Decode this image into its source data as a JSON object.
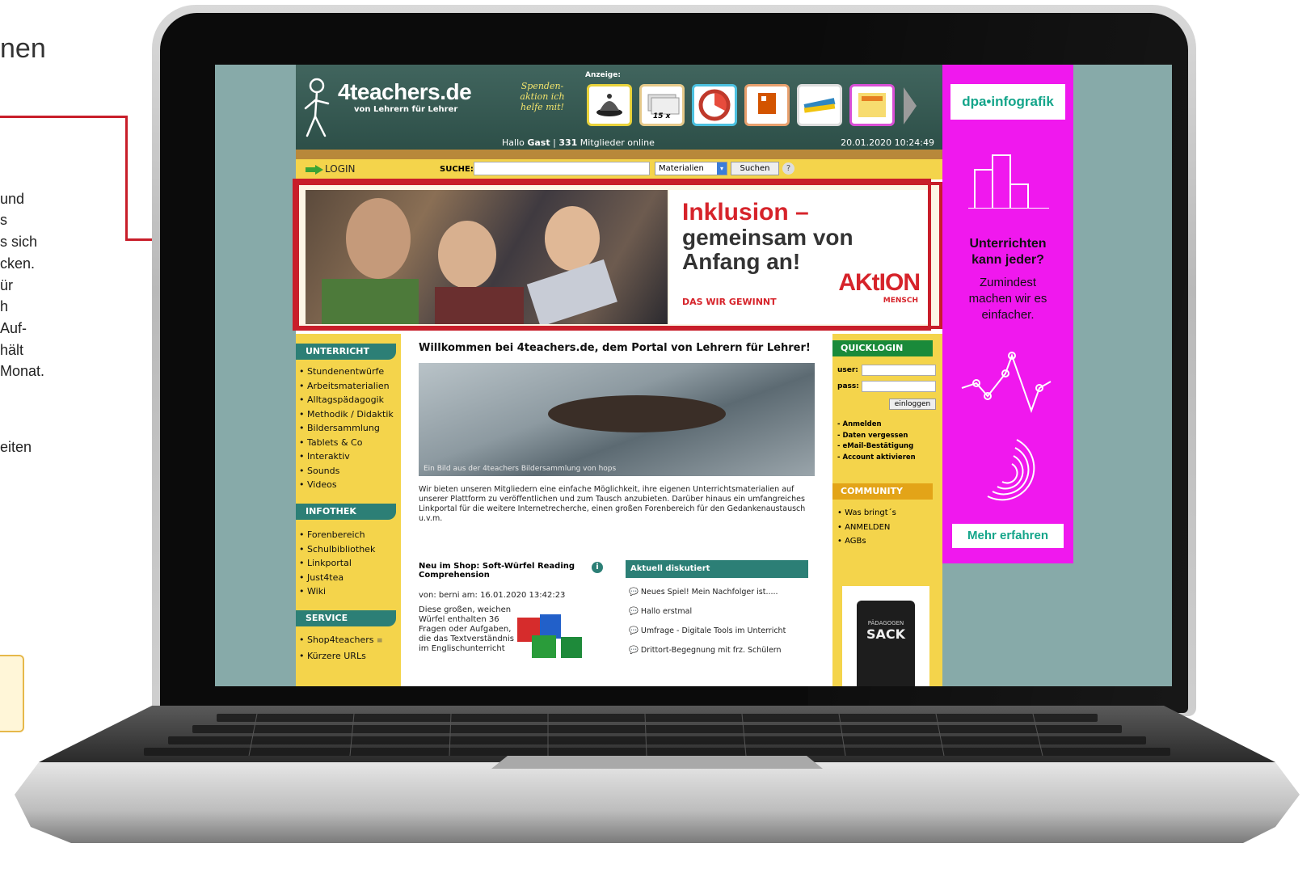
{
  "left_text": {
    "line0": "nen",
    "line1": "und",
    "line2": "s",
    "line3": "s sich",
    "line4": "cken.",
    "line5": "ür",
    "line6": "h",
    "line7": "Auf-",
    "line8": "hält",
    "line9": "Monat.",
    "line10": "eiten"
  },
  "site": {
    "logo_title": "4teachers.de",
    "logo_sub": "von Lehrern für Lehrer",
    "spenden": "Spenden-aktion ich helfe mit!",
    "anzeige": "Anzeige:",
    "ad_label": "15 x",
    "hello_prefix": "Hallo",
    "hello_user": "Gast",
    "hello_count": "331",
    "hello_suffix": "Mitglieder online",
    "datetime": "20.01.2020 10:24:49",
    "login": "LOGIN",
    "suche_label": "SUCHE:",
    "select_value": "Materialien",
    "search_button": "Suchen",
    "help": "?"
  },
  "banner": {
    "line1": "Inklusion –",
    "line2": "gemeinsam von Anfang an!",
    "tagline": "DAS WIR GEWINNT",
    "brand": "AKtION",
    "brand_sub": "MENSCH"
  },
  "left_nav": {
    "unterricht_title": "UNTERRICHT",
    "unterricht": [
      "Stundenentwürfe",
      "Arbeitsmaterialien",
      "Alltagspädagogik",
      "Methodik / Didaktik",
      "Bildersammlung",
      "Tablets & Co",
      "Interaktiv",
      "Sounds",
      "Videos"
    ],
    "infothek_title": "INFOTHEK",
    "infothek": [
      "Forenbereich",
      "Schulbibliothek",
      "Linkportal",
      "Just4tea",
      "Wiki"
    ],
    "service_title": "SERVICE",
    "service": [
      "Shop4teachers",
      "Kürzere URLs"
    ]
  },
  "main": {
    "welcome": "Willkommen bei 4teachers.de, dem Portal von Lehrern für Lehrer!",
    "image_caption": "Ein Bild aus der 4teachers Bildersammlung von hops",
    "intro": "Wir bieten unseren Mitgliedern eine einfache Möglichkeit, ihre eigenen Unterrichtsmaterialien auf unserer Plattform zu veröffentlichen und zum Tausch anzubieten. Darüber hinaus ein umfangreiches Linkportal für die weitere Internetrecherche, einen großen Forenbereich für den Gedankenaustausch u.v.m.",
    "shop_title": "Neu im Shop: Soft-Würfel Reading Comprehension",
    "shop_meta": "von: berni am: 16.01.2020 13:42:23",
    "shop_text": [
      "Diese großen, weichen",
      "Würfel enthalten 36",
      "Fragen oder Aufgaben,",
      "die das Textverständnis",
      "im Englischunterricht"
    ],
    "info_icon": "i",
    "discuss_title": "Aktuell diskutiert",
    "discuss": [
      "Neues Spiel! Mein Nachfolger ist.....",
      "Hallo erstmal",
      "Umfrage - Digitale Tools im Unterricht",
      "Drittort-Begegnung mit frz. Schülern"
    ]
  },
  "right_col": {
    "quicklogin": "QUICKLOGIN",
    "user_label": "user:",
    "pass_label": "pass:",
    "login_button": "einloggen",
    "links": [
      "- Anmelden",
      "- Daten vergessen",
      "- eMail-Bestätigung",
      "- Account aktivieren"
    ],
    "community": "COMMUNITY",
    "community_links": [
      "• Was bringt´s",
      "• ANMELDEN",
      "• AGBs"
    ],
    "sack_top": "PÄDAGOGEN",
    "sack": "SACK"
  },
  "pink_ad": {
    "brand": "dpa•infografik",
    "head1": "Unterrichten",
    "head2": "kann jeder?",
    "sub1": "Zumindest",
    "sub2": "machen wir es",
    "sub3": "einfacher.",
    "cta": "Mehr erfahren"
  },
  "colors": {
    "accent_red": "#c81e2a",
    "site_teal": "#2c7f76",
    "site_yellow": "#f4d44b",
    "ad_pink": "#f018ee"
  }
}
